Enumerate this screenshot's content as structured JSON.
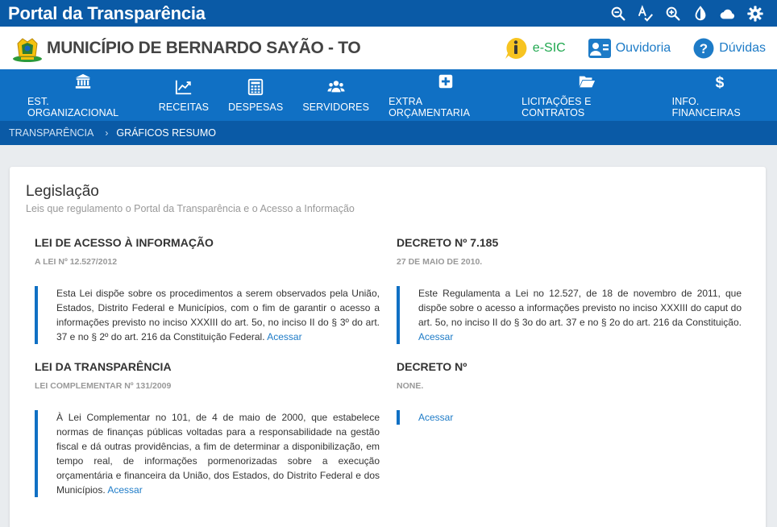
{
  "topbar": {
    "title": "Portal da Transparência",
    "tools": [
      "zoom-out-icon",
      "spell-check-icon",
      "zoom-in-icon",
      "contrast-icon",
      "cloud-icon",
      "settings-icon"
    ]
  },
  "header": {
    "municipality": "MUNICÍPIO DE BERNARDO SAYÃO - TO",
    "links": {
      "esic": "e-SIC",
      "ouvidoria": "Ouvidoria",
      "duvidas": "Dúvidas"
    }
  },
  "nav": [
    {
      "label": "EST. ORGANIZACIONAL",
      "icon": "bank-icon"
    },
    {
      "label": "RECEITAS",
      "icon": "chart-line-icon"
    },
    {
      "label": "DESPESAS",
      "icon": "calculator-icon"
    },
    {
      "label": "SERVIDORES",
      "icon": "users-icon"
    },
    {
      "label": "EXTRA ORÇAMENTARIA",
      "icon": "plus-square-icon"
    },
    {
      "label": "LICITAÇÕES E CONTRATOS",
      "icon": "folder-open-icon"
    },
    {
      "label": "INFO. FINANCEIRAS",
      "icon": "dollar-icon"
    }
  ],
  "breadcrumb": {
    "root": "TRANSPARÊNCIA",
    "current": "GRÁFICOS RESUMO"
  },
  "legislacao": {
    "title": "Legislação",
    "subtitle": "Leis que regulamento o Portal da Transparência e o Acesso a Informação",
    "access_label": "Acessar",
    "laws": [
      {
        "title": "LEI DE ACESSO À INFORMAÇÃO",
        "subtitle": "A LEI Nº 12.527/2012",
        "text": "Esta Lei dispõe sobre os procedimentos a serem observados pela União, Estados, Distrito Federal e Municípios, com o fim de garantir o acesso a informações previsto no inciso XXXIII do art. 5o, no inciso II do § 3º do art. 37 e no § 2º do art. 216 da Constituição Federal."
      },
      {
        "title": "DECRETO Nº 7.185",
        "subtitle": "27 DE MAIO DE 2010.",
        "text": "Este Regulamenta a Lei no 12.527, de 18 de novembro de 2011, que dispõe sobre o acesso a informações previsto no inciso XXXIII do caput do art. 5o, no inciso II do § 3o do art. 37 e no § 2o do art. 216 da Constituição."
      },
      {
        "title": "LEI DA TRANSPARÊNCIA",
        "subtitle": "LEI COMPLEMENTAR Nº 131/2009",
        "text": "À Lei Complementar no 101, de 4 de maio de 2000, que estabelece normas de finanças públicas voltadas para a responsabilidade na gestão fiscal e dá outras providências, a fim de determinar a disponibilização, em tempo real, de informações pormenorizadas sobre a execução orçamentária e financeira da União, dos Estados, do Distrito Federal e dos Municípios."
      },
      {
        "title": "DECRETO Nº",
        "subtitle": "NONE.",
        "text": ""
      }
    ]
  }
}
